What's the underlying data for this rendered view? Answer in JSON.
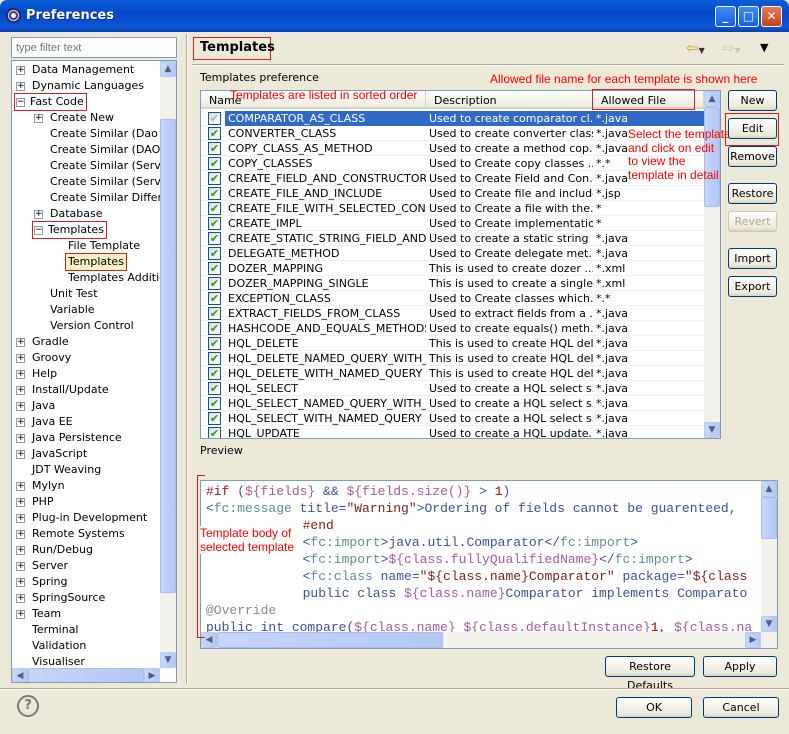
{
  "window": {
    "title": "Preferences",
    "controls": [
      "minimize",
      "maximize",
      "close"
    ]
  },
  "filter": {
    "placeholder": "type filter text"
  },
  "tree": [
    {
      "label": "Data Management",
      "level": 0,
      "toggle": "+"
    },
    {
      "label": "Dynamic Languages",
      "level": 0,
      "toggle": "+"
    },
    {
      "label": "Fast Code",
      "level": 0,
      "toggle": "-",
      "highlight": true
    },
    {
      "label": "Create New",
      "level": 1,
      "toggle": "+"
    },
    {
      "label": "Create Similar (Dao Se",
      "level": 1
    },
    {
      "label": "Create Similar (DAO to",
      "level": 1
    },
    {
      "label": "Create Similar (Service",
      "level": 1
    },
    {
      "label": "Create Similar (Service",
      "level": 1
    },
    {
      "label": "Create Similar Differen",
      "level": 1
    },
    {
      "label": "Database",
      "level": 1,
      "toggle": "+"
    },
    {
      "label": "Templates",
      "level": 1,
      "toggle": "-",
      "highlight": true
    },
    {
      "label": "File Template",
      "level": 2
    },
    {
      "label": "Templates",
      "level": 2,
      "selected": true,
      "highlight": true
    },
    {
      "label": "Templates Addition",
      "level": 2
    },
    {
      "label": "Unit Test",
      "level": 1
    },
    {
      "label": "Variable",
      "level": 1
    },
    {
      "label": "Version Control",
      "level": 1
    },
    {
      "label": "Gradle",
      "level": 0,
      "toggle": "+"
    },
    {
      "label": "Groovy",
      "level": 0,
      "toggle": "+"
    },
    {
      "label": "Help",
      "level": 0,
      "toggle": "+"
    },
    {
      "label": "Install/Update",
      "level": 0,
      "toggle": "+"
    },
    {
      "label": "Java",
      "level": 0,
      "toggle": "+"
    },
    {
      "label": "Java EE",
      "level": 0,
      "toggle": "+"
    },
    {
      "label": "Java Persistence",
      "level": 0,
      "toggle": "+"
    },
    {
      "label": "JavaScript",
      "level": 0,
      "toggle": "+"
    },
    {
      "label": "JDT Weaving",
      "level": 0
    },
    {
      "label": "Mylyn",
      "level": 0,
      "toggle": "+"
    },
    {
      "label": "PHP",
      "level": 0,
      "toggle": "+"
    },
    {
      "label": "Plug-in Development",
      "level": 0,
      "toggle": "+"
    },
    {
      "label": "Remote Systems",
      "level": 0,
      "toggle": "+"
    },
    {
      "label": "Run/Debug",
      "level": 0,
      "toggle": "+"
    },
    {
      "label": "Server",
      "level": 0,
      "toggle": "+"
    },
    {
      "label": "Spring",
      "level": 0,
      "toggle": "+"
    },
    {
      "label": "SpringSource",
      "level": 0,
      "toggle": "+"
    },
    {
      "label": "Team",
      "level": 0,
      "toggle": "+"
    },
    {
      "label": "Terminal",
      "level": 0
    },
    {
      "label": "Validation",
      "level": 0
    },
    {
      "label": "Visualiser",
      "level": 0
    }
  ],
  "page": {
    "title": "Templates",
    "section_label": "Templates preference",
    "preview_label": "Preview"
  },
  "table": {
    "columns": [
      "Name",
      "Description",
      "Allowed File Names"
    ],
    "rows": [
      {
        "checked": true,
        "selected": true,
        "name": "COMPARATOR_AS_CLASS",
        "desc": "Used to create comparator cl...",
        "files": "*.java"
      },
      {
        "checked": true,
        "name": "CONVERTER_CLASS",
        "desc": "Used to create converter class",
        "files": "*.java"
      },
      {
        "checked": true,
        "name": "COPY_CLASS_AS_METHOD",
        "desc": "Used to create a method cop...",
        "files": "*.java"
      },
      {
        "checked": true,
        "name": "COPY_CLASSES",
        "desc": "Used to Create copy classes ...",
        "files": "*.*"
      },
      {
        "checked": true,
        "name": "CREATE_FIELD_AND_CONSTRUCTOR",
        "desc": "Used to Create Field and Con...",
        "files": "*.java"
      },
      {
        "checked": true,
        "name": "CREATE_FILE_AND_INCLUDE",
        "desc": "Used to Create file and include.",
        "files": "*.jsp"
      },
      {
        "checked": true,
        "name": "CREATE_FILE_WITH_SELECTED_CON...",
        "desc": "Used to Create a file with the...",
        "files": "*"
      },
      {
        "checked": true,
        "name": "CREATE_IMPL",
        "desc": "Used to Create implementatio...",
        "files": "*"
      },
      {
        "checked": true,
        "name": "CREATE_STATIC_STRING_FIELD_AND...",
        "desc": "Used to create a static string ...",
        "files": "*.java"
      },
      {
        "checked": true,
        "name": "DELEGATE_METHOD",
        "desc": "Used to Create delegate met...",
        "files": "*.java"
      },
      {
        "checked": true,
        "name": "DOZER_MAPPING",
        "desc": "This is used to create dozer ...",
        "files": "*.xml"
      },
      {
        "checked": true,
        "name": "DOZER_MAPPING_SINGLE",
        "desc": "This is used to create a single...",
        "files": "*.xml"
      },
      {
        "checked": true,
        "name": "EXCEPTION_CLASS",
        "desc": "Used to Create classes which...",
        "files": "*.*"
      },
      {
        "checked": true,
        "name": "EXTRACT_FIELDS_FROM_CLASS",
        "desc": "Used to extract fields from a ...",
        "files": "*.java"
      },
      {
        "checked": true,
        "name": "HASHCODE_AND_EQUALS_METHODS",
        "desc": "Used to create equals() meth...",
        "files": "*.java"
      },
      {
        "checked": true,
        "name": "HQL_DELETE",
        "desc": "This is used to create HQL del...",
        "files": "*.java"
      },
      {
        "checked": true,
        "name": "HQL_DELETE_NAMED_QUERY_WITH_...",
        "desc": "This is used to create HQL del...",
        "files": "*.java"
      },
      {
        "checked": true,
        "name": "HQL_DELETE_WITH_NAMED_QUERY",
        "desc": "This is used to create HQL del...",
        "files": "*.java"
      },
      {
        "checked": true,
        "name": "HQL_SELECT",
        "desc": "Used to create a HQL select s...",
        "files": "*.java"
      },
      {
        "checked": true,
        "name": "HQL_SELECT_NAMED_QUERY_WITH_...",
        "desc": "Used to create a HQL select s...",
        "files": "*.java"
      },
      {
        "checked": true,
        "name": "HQL_SELECT_WITH_NAMED_QUERY",
        "desc": "Used to create a HQL select s...",
        "files": "*.java"
      },
      {
        "checked": true,
        "name": "HQL_UPDATE",
        "desc": "Used to create a HQL update...",
        "files": "*.java"
      }
    ]
  },
  "buttons": {
    "new": "New",
    "edit": "Edit",
    "remove": "Remove",
    "restore": "Restore",
    "revert": "Revert",
    "import": "Import",
    "export": "Export",
    "restore_defaults": "Restore Defaults",
    "apply": "Apply",
    "ok": "OK",
    "cancel": "Cancel"
  },
  "preview_code": [
    {
      "indent": 0,
      "segs": [
        [
          "dir",
          "#if"
        ],
        [
          "plain",
          " ("
        ],
        [
          "var",
          "${fields}"
        ],
        [
          "plain",
          " && "
        ],
        [
          "var",
          "${fields.size()}"
        ],
        [
          "plain",
          " > "
        ],
        [
          "num",
          "1"
        ],
        [
          "plain",
          ")"
        ]
      ]
    },
    {
      "indent": 0,
      "segs": [
        [
          "plain",
          "<"
        ],
        [
          "tag",
          "fc:message"
        ],
        [
          "attr",
          " title="
        ],
        [
          "str",
          "\"Warning\""
        ],
        [
          "plain",
          ">"
        ],
        [
          "txt",
          "Ordering of fields cannot be guarenteed, "
        ]
      ]
    },
    {
      "indent": 12,
      "segs": [
        [
          "dir",
          "#end"
        ]
      ]
    },
    {
      "indent": 12,
      "segs": [
        [
          "plain",
          "<"
        ],
        [
          "tag",
          "fc:import"
        ],
        [
          "plain",
          ">"
        ],
        [
          "txt",
          "java.util.Comparator"
        ],
        [
          "plain",
          "</"
        ],
        [
          "tag",
          "fc:import"
        ],
        [
          "plain",
          ">"
        ]
      ]
    },
    {
      "indent": 12,
      "segs": [
        [
          "plain",
          "<"
        ],
        [
          "tag",
          "fc:import"
        ],
        [
          "plain",
          ">"
        ],
        [
          "var",
          "${class.fullyQualifiedName}"
        ],
        [
          "plain",
          "</"
        ],
        [
          "tag",
          "fc:import"
        ],
        [
          "plain",
          ">"
        ]
      ]
    },
    {
      "indent": 12,
      "segs": [
        [
          "plain",
          "<"
        ],
        [
          "tag",
          "fc:class"
        ],
        [
          "attr",
          " name="
        ],
        [
          "str",
          "\"${class.name}Comparator\""
        ],
        [
          "attr",
          " package="
        ],
        [
          "str",
          "\"${class"
        ]
      ]
    },
    {
      "indent": 12,
      "segs": [
        [
          "txt",
          "public class "
        ],
        [
          "var",
          "${class.name}"
        ],
        [
          "txt",
          "Comparator implements Comparato"
        ]
      ]
    },
    {
      "indent": 0,
      "segs": [
        [
          "ann",
          "@Override"
        ]
      ]
    },
    {
      "indent": 0,
      "segs": [
        [
          "txt",
          "public int compare("
        ],
        [
          "var",
          "${class.name}"
        ],
        [
          "txt",
          " "
        ],
        [
          "var",
          "${class.defaultInstance}"
        ],
        [
          "num",
          "1"
        ],
        [
          "txt",
          ", "
        ],
        [
          "var",
          "${class.na"
        ]
      ]
    }
  ],
  "annotations": {
    "allowed": "Allowed file name for each template is shown here",
    "sorted": "Templates are listed in sorted order",
    "edit": [
      "Select the template",
      "and click on edit",
      "to view the",
      "template in detail"
    ],
    "body": [
      "Template body of",
      "selected template"
    ]
  },
  "colors": {
    "title_bar": "#0348c6",
    "selection": "#316ac5",
    "annotation": "#ff0000"
  }
}
